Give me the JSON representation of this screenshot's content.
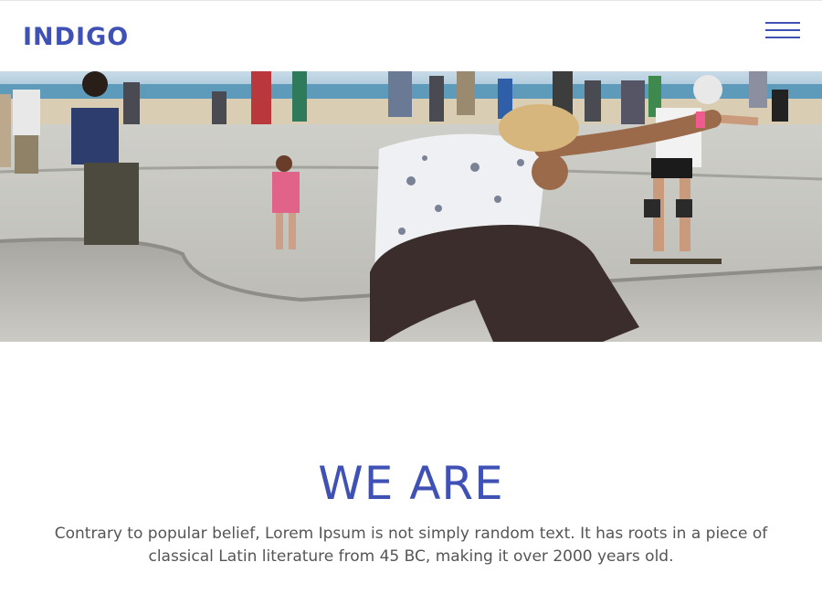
{
  "header": {
    "brand": "INDIGO",
    "menu_icon": "hamburger-menu-icon",
    "accent_color": "#3f51b5"
  },
  "hero": {
    "image": "photo of a skateboarder performing a trick in a concrete skate park",
    "slides": 5,
    "active_slide": 1
  },
  "about": {
    "title": "WE ARE",
    "text": "Contrary to popular belief, Lorem Ipsum is not simply random text. It has roots in a piece of classical Latin literature from 45 BC, making it over 2000 years old."
  }
}
